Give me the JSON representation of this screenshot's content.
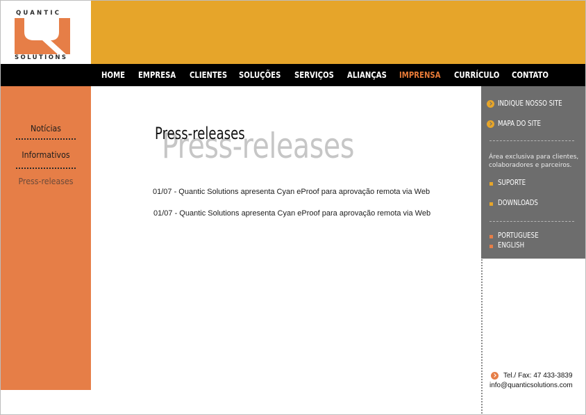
{
  "logo": {
    "top_text": "QUANTIC",
    "bottom_text": "SOLUTIONS"
  },
  "colors": {
    "banner": "#e6a52a",
    "nav_bg": "#000000",
    "nav_active": "#e67a37",
    "left_col": "#e67e47",
    "right_panel": "#6d6d6d"
  },
  "nav": {
    "items": [
      "HOME",
      "EMPRESA",
      "CLIENTES",
      "SOLUÇÕES",
      "SERVIÇOS",
      "ALIANÇAS",
      "IMPRENSA",
      "CURRÍCULO",
      "CONTATO"
    ],
    "active": "IMPRENSA"
  },
  "left_menu": {
    "items": [
      "Notícias",
      "Informativos",
      "Press-releases"
    ],
    "current": "Press-releases"
  },
  "main": {
    "title": "Press-releases",
    "title_shadow": "Press-releases",
    "news": [
      "01/07 - Quantic Solutions apresenta Cyan eProof para aprovação remota via Web",
      "01/07 - Quantic Solutions apresenta Cyan eProof para aprovação remota via Web"
    ]
  },
  "right_panel": {
    "indique": "INDIQUE NOSSO SITE",
    "mapa": "MAPA DO SITE",
    "exclusive_text": "Área exclusiva para clientes, colaboradores e parceiros.",
    "suporte": "SUPORTE",
    "downloads": "DOWNLOADS",
    "portuguese": "PORTUGUESE",
    "english": "ENGLISH"
  },
  "contact": {
    "phone": "Tel./ Fax: 47 433-3839",
    "email": "info@quanticsolutions.com"
  }
}
